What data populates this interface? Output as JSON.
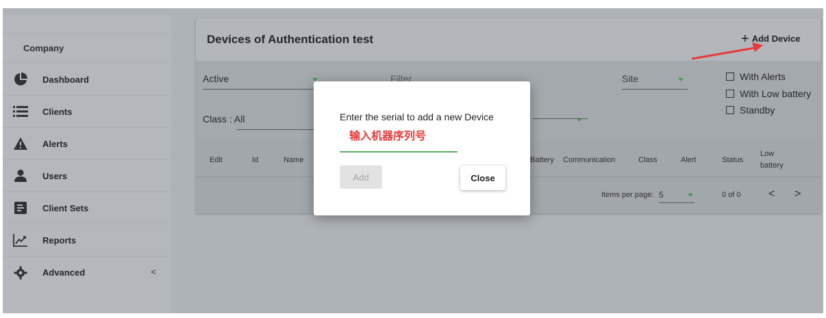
{
  "sidebar": {
    "company": "Company",
    "items": [
      {
        "label": "Dashboard",
        "icon": "pie-chart-icon"
      },
      {
        "label": "Clients",
        "icon": "list-icon"
      },
      {
        "label": "Alerts",
        "icon": "warning-icon"
      },
      {
        "label": "Users",
        "icon": "person-icon"
      },
      {
        "label": "Client Sets",
        "icon": "client-sets-icon"
      },
      {
        "label": "Reports",
        "icon": "trending-up-icon"
      },
      {
        "label": "Advanced",
        "icon": "gear-icon",
        "chevron": "<"
      }
    ]
  },
  "card": {
    "title": "Devices of Authentication test",
    "add_device": "Add Device",
    "filters": {
      "status": "Active",
      "filter_placeholder": "Filter",
      "site": "Site",
      "class": "Class : All"
    },
    "checkboxes": [
      "With Alerts",
      "With Low battery",
      "Standby"
    ],
    "columns": [
      "Edit",
      "Id",
      "Name",
      "Battery",
      "Communication",
      "Class",
      "Alert",
      "Status",
      "Low",
      "battery"
    ],
    "pager": {
      "items_per_page_label": "Items per page:",
      "items_per_page_value": "5",
      "range": "0 of 0",
      "prev": "<",
      "next": ">"
    }
  },
  "dialog": {
    "title": "Enter the serial to add a new Device",
    "annotation": "输入机器序列号",
    "serial_value": "",
    "add_label": "Add",
    "close_label": "Close"
  },
  "colors": {
    "overlay": "#aeb3b7",
    "accent_green": "#5aae62",
    "annotation_red": "#e83a3a"
  }
}
